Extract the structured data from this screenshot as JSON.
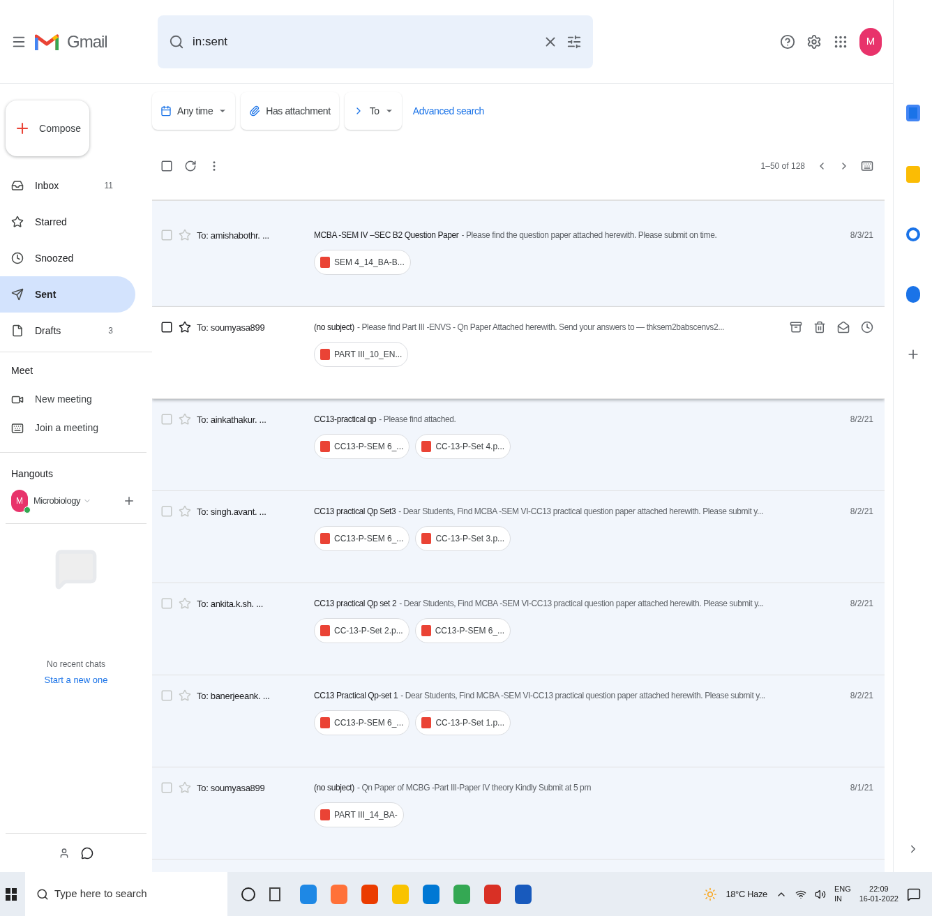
{
  "header": {
    "app_name": "Gmail",
    "search": {
      "value": "in:sent"
    },
    "avatar_letter": "M"
  },
  "filters": [
    {
      "kind": "calendar",
      "label": "Any time",
      "dropdown": true
    },
    {
      "kind": "attachment",
      "label": "Has attachment",
      "dropdown": false
    },
    {
      "kind": "send",
      "label": "To",
      "dropdown": true
    }
  ],
  "advanced_search": "Advanced search",
  "toolbar": {
    "pagination": "1–50 of 128"
  },
  "compose": "Compose",
  "sidebar": {
    "items": [
      {
        "kind": "inbox",
        "label": "Inbox",
        "count": "11",
        "selected": false
      },
      {
        "kind": "star",
        "label": "Starred",
        "selected": false
      },
      {
        "kind": "clock",
        "label": "Snoozed",
        "selected": false
      },
      {
        "kind": "send",
        "label": "Sent",
        "selected": true
      },
      {
        "kind": "file",
        "label": "Drafts",
        "count": "3",
        "selected": false
      }
    ]
  },
  "meet": {
    "title": "Meet",
    "items": [
      {
        "kind": "video",
        "label": "New meeting"
      },
      {
        "kind": "keyboard",
        "label": "Join a meeting"
      }
    ]
  },
  "hangouts": {
    "title": "Hangouts",
    "user": {
      "letter": "M",
      "name": "Microbiology",
      "online": true
    },
    "empty_text": "No recent chats",
    "start_link": "Start a new one"
  },
  "emails": [
    {
      "to": "To: amishabothr. ...",
      "subject": "MCBA -SEM IV –SEC B2 Question Paper",
      "snippet": "- Please find the question paper attached herewith. Please submit on time.",
      "date": "8/3/21",
      "hovered": false,
      "attachments": [
        "SEM 4_14_BA-B..."
      ]
    },
    {
      "to": "To: soumyasa899",
      "subject": "(no subject)",
      "snippet": "- Please find Part III -ENVS - Qn Paper Attached herewith. Send your answers to — thksem2babscenvs2...",
      "hovered": true,
      "attachments": [
        "PART III_10_EN..."
      ]
    },
    {
      "to": "To: ainkathakur. ...",
      "subject": "CC13-practical qp",
      "snippet": "- Please find attached.",
      "date": "8/2/21",
      "hovered": false,
      "attachments": [
        "CC13-P-SEM 6_...",
        "CC-13-P-Set 4.p..."
      ]
    },
    {
      "to": "To: singh.avant. ...",
      "subject": "CC13 practical Qp Set3",
      "snippet": "- Dear Students, Find MCBA -SEM VI-CC13 practical question paper attached herewith. Please submit y...",
      "date": "8/2/21",
      "hovered": false,
      "attachments": [
        "CC13-P-SEM 6_...",
        "CC-13-P-Set 3.p..."
      ]
    },
    {
      "to": "To: ankita.k.sh. ...",
      "subject": "CC13 practical Qp set 2",
      "snippet": "- Dear Students, Find MCBA -SEM VI-CC13 practical question paper attached herewith. Please submit y...",
      "date": "8/2/21",
      "hovered": false,
      "attachments": [
        "CC-13-P-Set 2.p...",
        "CC13-P-SEM 6_..."
      ]
    },
    {
      "to": "To: banerjeeank. ...",
      "subject": "CC13 Practical Qp-set 1",
      "snippet": "- Dear Students, Find MCBA -SEM VI-CC13 practical question paper attached herewith. Please submit y...",
      "date": "8/2/21",
      "hovered": false,
      "attachments": [
        "CC13-P-SEM 6_...",
        "CC-13-P-Set 1.p..."
      ]
    },
    {
      "to": "To: soumyasa899",
      "subject": "(no subject)",
      "snippet": "- Qn Paper of MCBG -Part III-Paper IV theory Kindly Submit at 5 pm",
      "date": "8/1/21",
      "hovered": false,
      "attachments": [
        "PART III_14_BA-"
      ]
    }
  ],
  "taskbar": {
    "search_placeholder": "Type here to search",
    "weather": "18°C Haze",
    "language": "ENG",
    "region": "IN",
    "time": "22:09",
    "date": "16-01-2022"
  }
}
